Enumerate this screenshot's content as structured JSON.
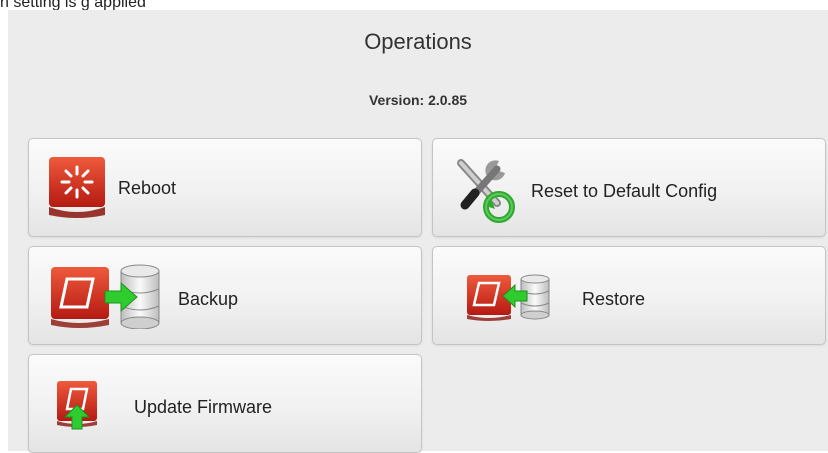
{
  "top_fragment": "n setting is g  applied",
  "operations": {
    "title": "Operations",
    "version_text": "Version: 2.0.85",
    "buttons": {
      "reboot": "Reboot",
      "reset": "Reset to Default Config",
      "backup": "Backup",
      "restore": "Restore",
      "update_firmware": "Update Firmware"
    }
  },
  "icons": {
    "reboot": "reboot-icon",
    "reset": "wrench-screwdriver-icon",
    "backup": "backup-icon",
    "restore": "restore-icon",
    "update_firmware": "firmware-upload-icon"
  },
  "colors": {
    "icon_red": "#d0241b",
    "arrow_green": "#2ecc2e",
    "panel_bg": "#ececec"
  }
}
